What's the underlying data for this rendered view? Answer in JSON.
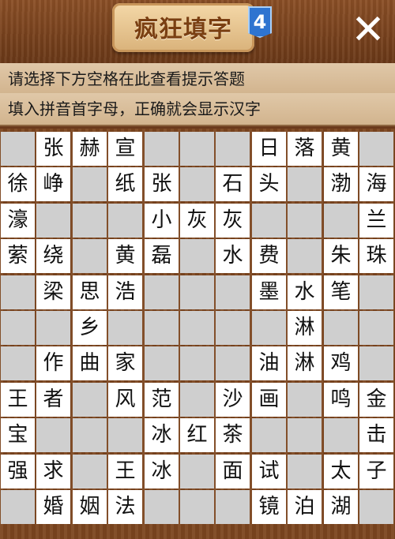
{
  "header": {
    "title": "疯狂填字",
    "level_badge": "4",
    "close_label": "✕"
  },
  "hints": {
    "line1": "请选择下方空格在此查看提示答题",
    "line2": "填入拼音首字母，正确就会显示汉字"
  },
  "grid": {
    "rows": [
      [
        "",
        "张",
        "赫",
        "宣",
        "",
        "",
        "",
        "日",
        "落",
        "黄",
        ""
      ],
      [
        "徐",
        "峥",
        "",
        "纸",
        "张",
        "",
        "石",
        "头",
        "",
        "渤",
        "海"
      ],
      [
        "濠",
        "",
        "",
        "",
        "小",
        "灰",
        "灰",
        "",
        "",
        "",
        "兰"
      ],
      [
        "萦",
        "绕",
        "",
        "黄",
        "磊",
        "",
        "水",
        "费",
        "",
        "朱",
        "珠"
      ],
      [
        "",
        "梁",
        "思",
        "浩",
        "",
        "",
        "",
        "墨",
        "水",
        "笔",
        ""
      ],
      [
        "",
        "",
        "乡",
        "",
        "",
        "",
        "",
        "",
        "淋",
        "",
        ""
      ],
      [
        "",
        "作",
        "曲",
        "家",
        "",
        "",
        "",
        "油",
        "淋",
        "鸡",
        ""
      ],
      [
        "王",
        "者",
        "",
        "风",
        "范",
        "",
        "沙",
        "画",
        "",
        "鸣",
        "金"
      ],
      [
        "宝",
        "",
        "",
        "",
        "冰",
        "红",
        "茶",
        "",
        "",
        "",
        "击"
      ],
      [
        "强",
        "求",
        "",
        "王",
        "冰",
        "",
        "面",
        "试",
        "",
        "太",
        "子"
      ],
      [
        "",
        "婚",
        "姻",
        "法",
        "",
        "",
        "",
        "镜",
        "泊",
        "湖",
        ""
      ]
    ]
  }
}
